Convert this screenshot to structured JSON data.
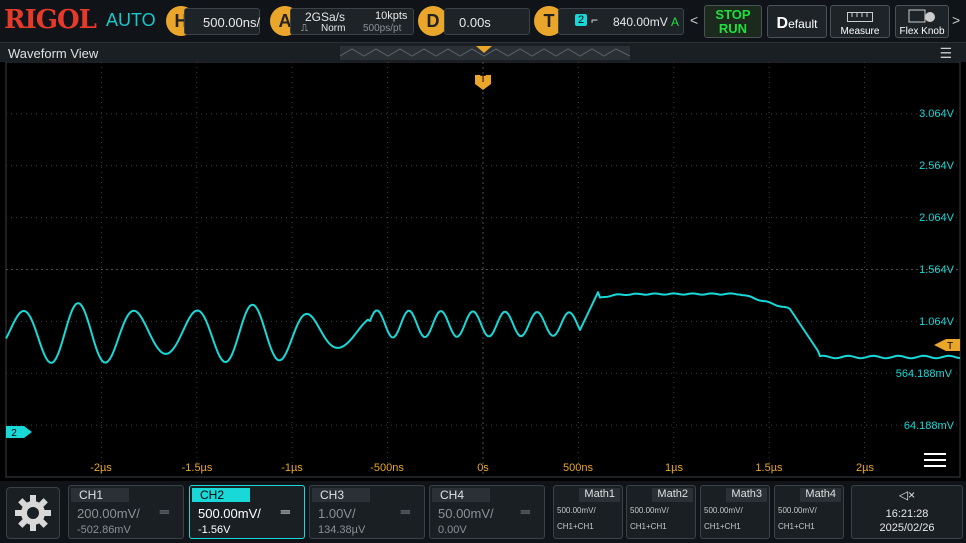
{
  "brand": {
    "logo": "RIGOL",
    "mode": "AUTO"
  },
  "horizontal": {
    "letter": "H",
    "timebase": "500.00ns/"
  },
  "acquire": {
    "letter": "A",
    "sample_rate": "2GSa/s",
    "memory": "10kpts",
    "mode": "Norm",
    "resolution": "500ps/pt"
  },
  "delay": {
    "letter": "D",
    "value": "0.00s"
  },
  "trigger": {
    "letter": "T",
    "source": "2",
    "level": "840.00mV",
    "coupling": "A"
  },
  "buttons": {
    "stop": "STOP",
    "run": "RUN",
    "default_d": "D",
    "default_rest": "efault",
    "measure": "Measure",
    "flex_knob": "Flex Knob"
  },
  "waveform_view": {
    "title": "Waveform View",
    "trigger_marker": "T",
    "channel_marker": "2"
  },
  "volt_labels": [
    "3.064V",
    "2.564V",
    "2.064V",
    "1.564V",
    "1.064V",
    "564.188mV",
    "64.188mV"
  ],
  "time_labels": [
    "-2µs",
    "-1.5µs",
    "-1µs",
    "-500ns",
    "0s",
    "500ns",
    "1µs",
    "1.5µs",
    "2µs"
  ],
  "channels": [
    {
      "name": "CH1",
      "scale": "200.00mV/",
      "offset": "-502.86mV",
      "active": false
    },
    {
      "name": "CH2",
      "scale": "500.00mV/",
      "offset": "-1.56V",
      "active": true
    },
    {
      "name": "CH3",
      "scale": "1.00V/",
      "offset": "134.38µV",
      "active": false
    },
    {
      "name": "CH4",
      "scale": "50.00mV/",
      "offset": "0.00V",
      "active": false
    }
  ],
  "maths": [
    {
      "name": "Math1",
      "scale": "500.00mV/",
      "source": "CH1+CH1"
    },
    {
      "name": "Math2",
      "scale": "500.00mV/",
      "source": "CH1+CH1"
    },
    {
      "name": "Math3",
      "scale": "500.00mV/",
      "source": "CH1+CH1"
    },
    {
      "name": "Math4",
      "scale": "500.00mV/",
      "source": "CH1+CH1"
    }
  ],
  "status": {
    "time": "16:21:28",
    "date": "2025/02/26"
  },
  "colors": {
    "ch2": "#18d8d8",
    "trigger": "#e9a62a",
    "brand": "#e53a2a",
    "run": "#20e040"
  },
  "icons": {
    "gear": "gear-icon",
    "speaker": "speaker-icon",
    "menu": "hamburger-icon"
  }
}
